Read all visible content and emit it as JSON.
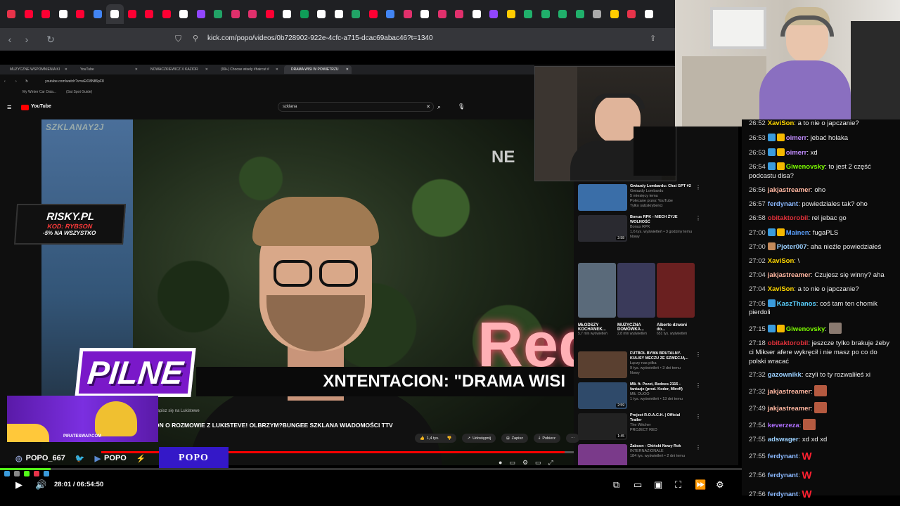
{
  "outer_browser": {
    "url": "kick.com/popo/videos/0b728902-922e-4cfc-a715-dcac69abac46?t=1340",
    "tab_colors": [
      "#e8334a",
      "#ff0033",
      "#ff0033",
      "#ffffff",
      "#ff0033",
      "#4285f4",
      "#ffffff",
      "#ff0033",
      "#ff0033",
      "#ff0033",
      "#ffffff",
      "#9146ff",
      "#21a366",
      "#e1306c",
      "#e1306c",
      "#ff0033",
      "#ffffff",
      "#0f9d58",
      "#ffffff",
      "#ffffff",
      "#21a366",
      "#ff0033",
      "#4285f4",
      "#e1306c",
      "#ffffff",
      "#e1306c",
      "#e1306c",
      "#ffffff",
      "#9146ff",
      "#ffcc00",
      "#20b06b",
      "#20b06b",
      "#20b06b",
      "#20b06b",
      "#aaaaaa",
      "#ffcc00",
      "#e8334a",
      "#ffffff"
    ]
  },
  "inner_browser": {
    "tabs": [
      {
        "label": "MUZYCZNE WSPOMNIENIA KI"
      },
      {
        "label": "YouTube"
      },
      {
        "label": "NOWACZKIEWICZ X KAZIOR"
      },
      {
        "label": "(99+) Choose wisely #haircut #"
      },
      {
        "label": "DRAMA WISI W POWIETRZU"
      }
    ],
    "url": "youtube.com/watch?v=wEiO8N86pF8",
    "bookmarks": [
      "My Winter Car Data...",
      "(Sat Spot Guide)"
    ],
    "logo": "YouTube",
    "search_value": "szklana"
  },
  "video": {
    "watermark": "SZKLANAY2J",
    "badge": "PILNE",
    "headline": "XNTENTACION: \"DRAMA WISI",
    "neon_label": "NE",
    "neon_text": "Red",
    "progress": 0.98,
    "channel_line": "Zapisz się na Lukistewe",
    "title": "ON O ROZMOWIE Z LUKISTEVE! OLBRZYM?BUNGEE SZKLANA WIADOMOŚCI TTV",
    "likes": "1,4 tys.",
    "share": "Udostępnij",
    "save": "Zapisz",
    "download": "Pobierz"
  },
  "sidebar": {
    "top_videos": [
      {
        "title": "Gwiazdy Lombardu: Chat GPT #2",
        "channel": "Gwiazdy Lombardu",
        "meta": "5 miesięcy temu",
        "badge": "Polecane przez YouTube",
        "tag": "Tylko subskrybenci",
        "color": "#3a6ea8"
      },
      {
        "title": "Bonus RPK - NIECH ŻYJE WOLNOŚĆ",
        "channel": "Bonus RPK",
        "meta": "1,6 tys. wyświetleń • 3 godziny temu",
        "tag": "Nowy",
        "duration": "2:58",
        "color": "#2a2a30"
      }
    ],
    "shorts": [
      {
        "title": "MŁODSZY KOCHANEK...",
        "views": "5,7 mln wyświetleń",
        "color": "#5a6a7a"
      },
      {
        "title": "MUZYCZNA DOMÓWKA...",
        "views": "2,8 mln wyświetleń",
        "color": "#3a3a5a"
      },
      {
        "title": "Alberto dzwoni do...",
        "views": "651 tys. wyświetleń",
        "color": "#6a2020"
      }
    ],
    "bottom_videos": [
      {
        "title": "FUTBOL BYWA BRUTALNY. KULISY MECZU ZE SZWECJĄ...",
        "channel": "Łączy nas piłka",
        "meta": "9 tys. wyświetleń • 3 dni temu",
        "tag": "Nowy",
        "color": "#5a4030"
      },
      {
        "title": "MIŁ ft. Pezet, Bedoes 2115 - fantazje (prod. Koder, Miroff)",
        "channel": "MIŁ OUOO",
        "meta": "1 tys. wyświetleń • 13 dni temu",
        "duration": "2:59",
        "color": "#2f4a6a"
      },
      {
        "title": "Project R.O.A.C.H. | Official Trailer",
        "channel": "The Witcher",
        "meta": "PROJECT RED",
        "duration": "1:45",
        "color": "#222"
      },
      {
        "title": "Żabson - Chiński Nowy Rok",
        "channel": "INTERNAZIONALE",
        "meta": "184 tys. wyświetleń • 2 dni temu",
        "color": "#7a3a8a"
      }
    ]
  },
  "overlays": {
    "risky": {
      "brand": "RISKY.PL",
      "code": "KOD: RYBSON",
      "promo": "-5% NA WSZYSTKO"
    },
    "promo_site": "PIRATESWAP.COM",
    "socials": [
      {
        "icon": "instagram-icon",
        "label": "POPO_667"
      },
      {
        "icon": "twitter-icon",
        "label": ""
      },
      {
        "icon": "youtube-icon",
        "label": "POPO"
      },
      {
        "icon": "kick-icon",
        "label": ""
      }
    ],
    "brand_box": "POPO"
  },
  "chat": {
    "messages": [
      {
        "time": "26:52",
        "user": "XaviSon",
        "color": "#ffd700",
        "badges": [],
        "text": "a to nie o japczanie?"
      },
      {
        "time": "26:53",
        "user": "oimerr",
        "color": "#c18cff",
        "badges": [
          "#3a9bdc",
          "#f5b800"
        ],
        "text": "jebać holaka"
      },
      {
        "time": "26:53",
        "user": "oimerr",
        "color": "#c18cff",
        "badges": [
          "#3a9bdc",
          "#f5b800"
        ],
        "text": "xd"
      },
      {
        "time": "26:54",
        "user": "Giwenovsky",
        "color": "#7cfc00",
        "badges": [
          "#3a9bdc",
          "#f5b800"
        ],
        "text": "to jest 2 część podcastu disa?"
      },
      {
        "time": "26:56",
        "user": "jakjastreamer",
        "color": "#ffb6a0",
        "badges": [],
        "text": "oho"
      },
      {
        "time": "26:57",
        "user": "ferdynant",
        "color": "#8ab8ff",
        "badges": [],
        "text": "powiedziales tak? oho"
      },
      {
        "time": "26:58",
        "user": "obitaktorobil",
        "color": "#e0303a",
        "badges": [],
        "text": "rel jebac go"
      },
      {
        "time": "27:00",
        "user": "Mainen",
        "color": "#5aa0ff",
        "badges": [
          "#3a9bdc",
          "#f5b800"
        ],
        "text": "fugaPLS"
      },
      {
        "time": "27:00",
        "user": "Pjoter007",
        "color": "#9ad0ff",
        "badges": [
          "#c48a5a"
        ],
        "text": "aha nieźle powiedziałeś"
      },
      {
        "time": "27:02",
        "user": "XaviSon",
        "color": "#ffd700",
        "badges": [],
        "text": "\\"
      },
      {
        "time": "27:04",
        "user": "jakjastreamer",
        "color": "#ffb6a0",
        "badges": [],
        "text": "Czujesz się winny? aha"
      },
      {
        "time": "27:04",
        "user": "XaviSon",
        "color": "#ffd700",
        "badges": [],
        "text": "a to nie o japczanie?"
      },
      {
        "time": "27:05",
        "user": "KaszThanos",
        "color": "#5ad0ff",
        "badges": [
          "#3a9bdc"
        ],
        "text": "coś tam ten chomik pierdoli"
      },
      {
        "time": "27:15",
        "user": "Giwenovsky",
        "color": "#7cfc00",
        "badges": [
          "#3a9bdc",
          "#f5b800"
        ],
        "text": "",
        "emote": "cat-emote"
      },
      {
        "time": "27:18",
        "user": "obitaktorobil",
        "color": "#e0303a",
        "badges": [],
        "text": "jeszcze tylko brakuje żeby ci Mikser afere wykręcił i nie masz po co do polski wracać"
      },
      {
        "time": "27:32",
        "user": "gazownikk",
        "color": "#9ad0ff",
        "badges": [],
        "text": "czyli to ty rozwaliłeś xi"
      },
      {
        "time": "27:32",
        "user": "jakjastreamer",
        "color": "#ffb6a0",
        "badges": [],
        "text": "",
        "emote": "face-emote"
      },
      {
        "time": "27:49",
        "user": "jakjastreamer",
        "color": "#ffb6a0",
        "badges": [],
        "text": "",
        "emote": "face-emote"
      },
      {
        "time": "27:54",
        "user": "keverzeza",
        "color": "#b070ff",
        "badges": [],
        "text": "",
        "emote": "face-emote"
      },
      {
        "time": "27:55",
        "user": "adswager",
        "color": "#9ad0ff",
        "badges": [],
        "text": "xd xd xd"
      },
      {
        "time": "27:55",
        "user": "ferdynant",
        "color": "#8ab8ff",
        "badges": [],
        "text": "",
        "emote": "w-emote"
      },
      {
        "time": "27:56",
        "user": "ferdynant",
        "color": "#8ab8ff",
        "badges": [],
        "text": "",
        "emote": "w-emote"
      },
      {
        "time": "27:56",
        "user": "ferdynant",
        "color": "#8ab8ff",
        "badges": [],
        "text": "",
        "emote": "w-emote"
      }
    ],
    "w_emote_text": "W"
  },
  "player": {
    "timecode": "28:01 / 06:54:50",
    "progress": 0.068,
    "accent": "#53fc18"
  }
}
